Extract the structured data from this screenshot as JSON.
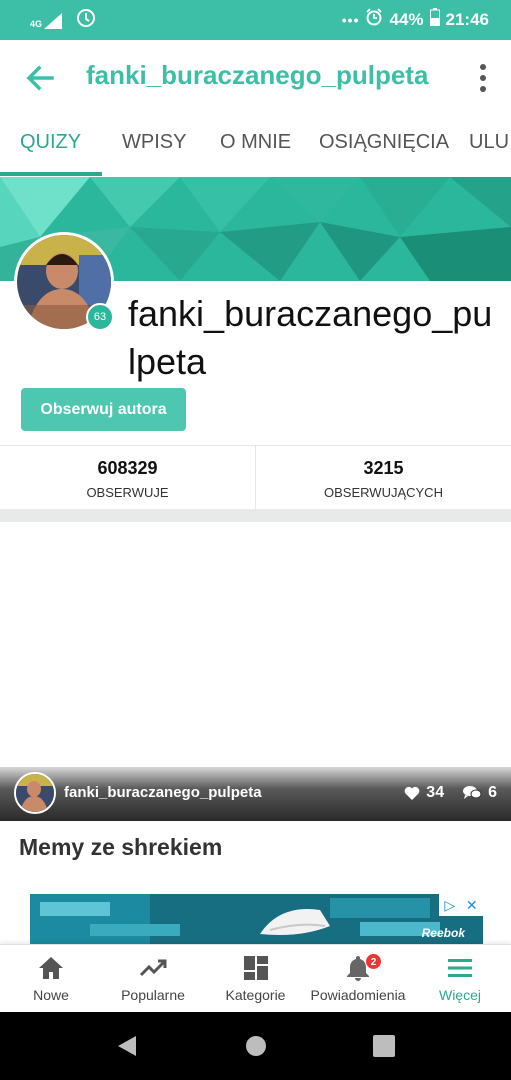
{
  "status_bar": {
    "network": "4G",
    "dots": "•••",
    "battery": "44%",
    "time": "21:46"
  },
  "app_bar": {
    "title": "fanki_buraczanego_pulpeta"
  },
  "tabs": [
    {
      "label": "QUIZY",
      "active": true
    },
    {
      "label": "WPISY",
      "active": false
    },
    {
      "label": "O MNIE",
      "active": false
    },
    {
      "label": "OSIĄGNIĘCIA",
      "active": false
    },
    {
      "label": "ULU",
      "active": false
    }
  ],
  "profile": {
    "username": "fanki_buraczanego_pulpeta",
    "level": "63",
    "follow_label": "Obserwuj autora"
  },
  "stats": [
    {
      "value": "608329",
      "label": "OBSERWUJE"
    },
    {
      "value": "3215",
      "label": "OBSERWUJĄCYCH"
    }
  ],
  "card": {
    "author": "fanki_buraczanego_pulpeta",
    "likes": "34",
    "comments": "6",
    "title": "Memy ze shrekiem"
  },
  "ad": {
    "brand": "Reebok"
  },
  "bottom_nav": [
    {
      "label": "Nowe",
      "icon": "home-icon"
    },
    {
      "label": "Popularne",
      "icon": "trending-icon"
    },
    {
      "label": "Kategorie",
      "icon": "categories-icon"
    },
    {
      "label": "Powiadomienia",
      "icon": "bell-icon",
      "badge": "2"
    },
    {
      "label": "Więcej",
      "icon": "menu-icon",
      "active": true
    }
  ],
  "colors": {
    "accent": "#3cbfa6",
    "accent_dark": "#2ba98f",
    "badge": "#e53935"
  }
}
